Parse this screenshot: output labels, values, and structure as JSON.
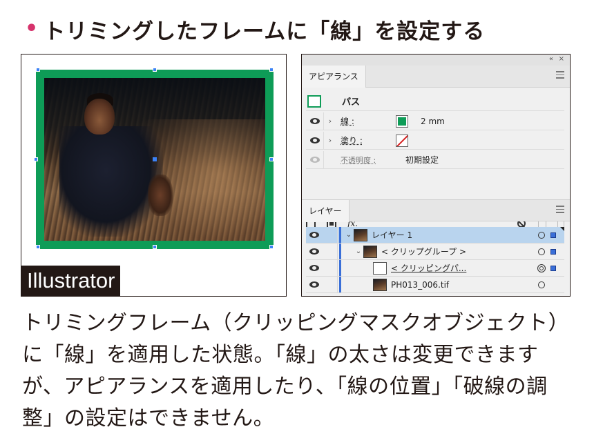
{
  "heading": {
    "bullet": "•",
    "text": "トリミングしたフレームに「線」を設定する"
  },
  "artboard": {
    "app_label": "Illustrator",
    "colors": {
      "frame": "#0e9c57",
      "handle": "#3b82f6"
    }
  },
  "panel": {
    "topbar": {
      "collapse_icon": "«",
      "close_icon": "×"
    },
    "appearance": {
      "tab_label": "アピアランス",
      "object_label": "パス",
      "stroke": {
        "label": "線 :",
        "value": "2 mm",
        "color": "#0e9c57"
      },
      "fill": {
        "label": "塗り :",
        "value": "none"
      },
      "opacity": {
        "label": "不透明度 :",
        "value": "初期設定"
      },
      "footer": {
        "fx_label": "fx."
      }
    },
    "layers": {
      "tab_label": "レイヤー",
      "rows": [
        {
          "name": "レイヤー 1",
          "selected": true
        },
        {
          "name": "< クリップグループ >"
        },
        {
          "name": "< クリッピングパ...",
          "underlined": true
        },
        {
          "name": "PH013_006.tif"
        }
      ]
    }
  },
  "caption": "トリミングフレーム（クリッピングマスクオブジェクト）に「線」を適用した状態。「線」の太さは変更できますが、アピアランスを適用したり、「線の位置」「破線の調整」の設定はできません。"
}
